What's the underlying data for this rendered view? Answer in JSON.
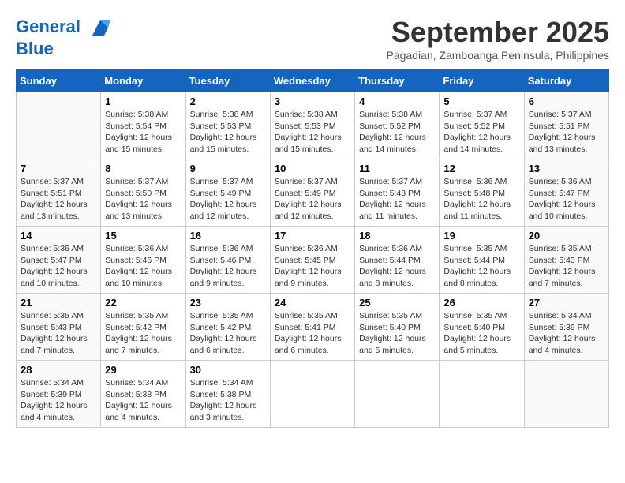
{
  "logo": {
    "line1": "General",
    "line2": "Blue"
  },
  "title": "September 2025",
  "subtitle": "Pagadian, Zamboanga Peninsula, Philippines",
  "days_of_week": [
    "Sunday",
    "Monday",
    "Tuesday",
    "Wednesday",
    "Thursday",
    "Friday",
    "Saturday"
  ],
  "weeks": [
    [
      {
        "day": "",
        "info": ""
      },
      {
        "day": "1",
        "info": "Sunrise: 5:38 AM\nSunset: 5:54 PM\nDaylight: 12 hours\nand 15 minutes."
      },
      {
        "day": "2",
        "info": "Sunrise: 5:38 AM\nSunset: 5:53 PM\nDaylight: 12 hours\nand 15 minutes."
      },
      {
        "day": "3",
        "info": "Sunrise: 5:38 AM\nSunset: 5:53 PM\nDaylight: 12 hours\nand 15 minutes."
      },
      {
        "day": "4",
        "info": "Sunrise: 5:38 AM\nSunset: 5:52 PM\nDaylight: 12 hours\nand 14 minutes."
      },
      {
        "day": "5",
        "info": "Sunrise: 5:37 AM\nSunset: 5:52 PM\nDaylight: 12 hours\nand 14 minutes."
      },
      {
        "day": "6",
        "info": "Sunrise: 5:37 AM\nSunset: 5:51 PM\nDaylight: 12 hours\nand 13 minutes."
      }
    ],
    [
      {
        "day": "7",
        "info": "Sunrise: 5:37 AM\nSunset: 5:51 PM\nDaylight: 12 hours\nand 13 minutes."
      },
      {
        "day": "8",
        "info": "Sunrise: 5:37 AM\nSunset: 5:50 PM\nDaylight: 12 hours\nand 13 minutes."
      },
      {
        "day": "9",
        "info": "Sunrise: 5:37 AM\nSunset: 5:49 PM\nDaylight: 12 hours\nand 12 minutes."
      },
      {
        "day": "10",
        "info": "Sunrise: 5:37 AM\nSunset: 5:49 PM\nDaylight: 12 hours\nand 12 minutes."
      },
      {
        "day": "11",
        "info": "Sunrise: 5:37 AM\nSunset: 5:48 PM\nDaylight: 12 hours\nand 11 minutes."
      },
      {
        "day": "12",
        "info": "Sunrise: 5:36 AM\nSunset: 5:48 PM\nDaylight: 12 hours\nand 11 minutes."
      },
      {
        "day": "13",
        "info": "Sunrise: 5:36 AM\nSunset: 5:47 PM\nDaylight: 12 hours\nand 10 minutes."
      }
    ],
    [
      {
        "day": "14",
        "info": "Sunrise: 5:36 AM\nSunset: 5:47 PM\nDaylight: 12 hours\nand 10 minutes."
      },
      {
        "day": "15",
        "info": "Sunrise: 5:36 AM\nSunset: 5:46 PM\nDaylight: 12 hours\nand 10 minutes."
      },
      {
        "day": "16",
        "info": "Sunrise: 5:36 AM\nSunset: 5:46 PM\nDaylight: 12 hours\nand 9 minutes."
      },
      {
        "day": "17",
        "info": "Sunrise: 5:36 AM\nSunset: 5:45 PM\nDaylight: 12 hours\nand 9 minutes."
      },
      {
        "day": "18",
        "info": "Sunrise: 5:36 AM\nSunset: 5:44 PM\nDaylight: 12 hours\nand 8 minutes."
      },
      {
        "day": "19",
        "info": "Sunrise: 5:35 AM\nSunset: 5:44 PM\nDaylight: 12 hours\nand 8 minutes."
      },
      {
        "day": "20",
        "info": "Sunrise: 5:35 AM\nSunset: 5:43 PM\nDaylight: 12 hours\nand 7 minutes."
      }
    ],
    [
      {
        "day": "21",
        "info": "Sunrise: 5:35 AM\nSunset: 5:43 PM\nDaylight: 12 hours\nand 7 minutes."
      },
      {
        "day": "22",
        "info": "Sunrise: 5:35 AM\nSunset: 5:42 PM\nDaylight: 12 hours\nand 7 minutes."
      },
      {
        "day": "23",
        "info": "Sunrise: 5:35 AM\nSunset: 5:42 PM\nDaylight: 12 hours\nand 6 minutes."
      },
      {
        "day": "24",
        "info": "Sunrise: 5:35 AM\nSunset: 5:41 PM\nDaylight: 12 hours\nand 6 minutes."
      },
      {
        "day": "25",
        "info": "Sunrise: 5:35 AM\nSunset: 5:40 PM\nDaylight: 12 hours\nand 5 minutes."
      },
      {
        "day": "26",
        "info": "Sunrise: 5:35 AM\nSunset: 5:40 PM\nDaylight: 12 hours\nand 5 minutes."
      },
      {
        "day": "27",
        "info": "Sunrise: 5:34 AM\nSunset: 5:39 PM\nDaylight: 12 hours\nand 4 minutes."
      }
    ],
    [
      {
        "day": "28",
        "info": "Sunrise: 5:34 AM\nSunset: 5:39 PM\nDaylight: 12 hours\nand 4 minutes."
      },
      {
        "day": "29",
        "info": "Sunrise: 5:34 AM\nSunset: 5:38 PM\nDaylight: 12 hours\nand 4 minutes."
      },
      {
        "day": "30",
        "info": "Sunrise: 5:34 AM\nSunset: 5:38 PM\nDaylight: 12 hours\nand 3 minutes."
      },
      {
        "day": "",
        "info": ""
      },
      {
        "day": "",
        "info": ""
      },
      {
        "day": "",
        "info": ""
      },
      {
        "day": "",
        "info": ""
      }
    ]
  ]
}
